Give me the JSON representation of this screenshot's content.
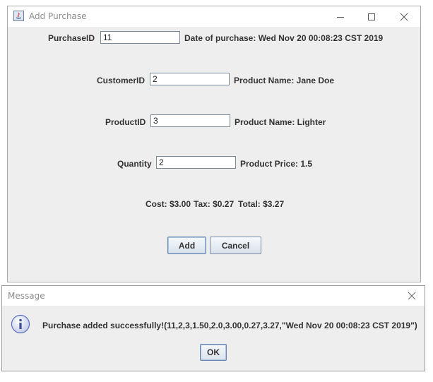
{
  "main_window": {
    "title": "Add Purchase",
    "purchase_id_label": "PurchaseID",
    "purchase_id_value": "11",
    "date_label": "Date of purchase: Wed Nov 20 00:08:23 CST 2019",
    "customer_id_label": "CustomerID",
    "customer_id_value": "2",
    "customer_name_label": "Product Name: Jane Doe",
    "product_id_label": "ProductID",
    "product_id_value": "3",
    "product_name_label": "Product Name: Lighter",
    "quantity_label": "Quantity",
    "quantity_value": "2",
    "product_price_label": "Product Price: 1.5",
    "cost_label": "Cost: $3.00",
    "tax_label": "Tax: $0.27",
    "total_label": "Total: $3.27",
    "add_button": "Add",
    "cancel_button": "Cancel"
  },
  "message_dialog": {
    "title": "Message",
    "message": "Purchase added successfully!(11,2,3,1.50,2.0,3.00,0.27,3.27,\"Wed Nov 20 00:08:23 CST 2019\")",
    "ok_button": "OK"
  },
  "colors": {
    "window_bg": "#eeeeee",
    "title_text": "#8c8c8c",
    "label_text": "#333333",
    "info_icon": "#5a6fbf"
  }
}
